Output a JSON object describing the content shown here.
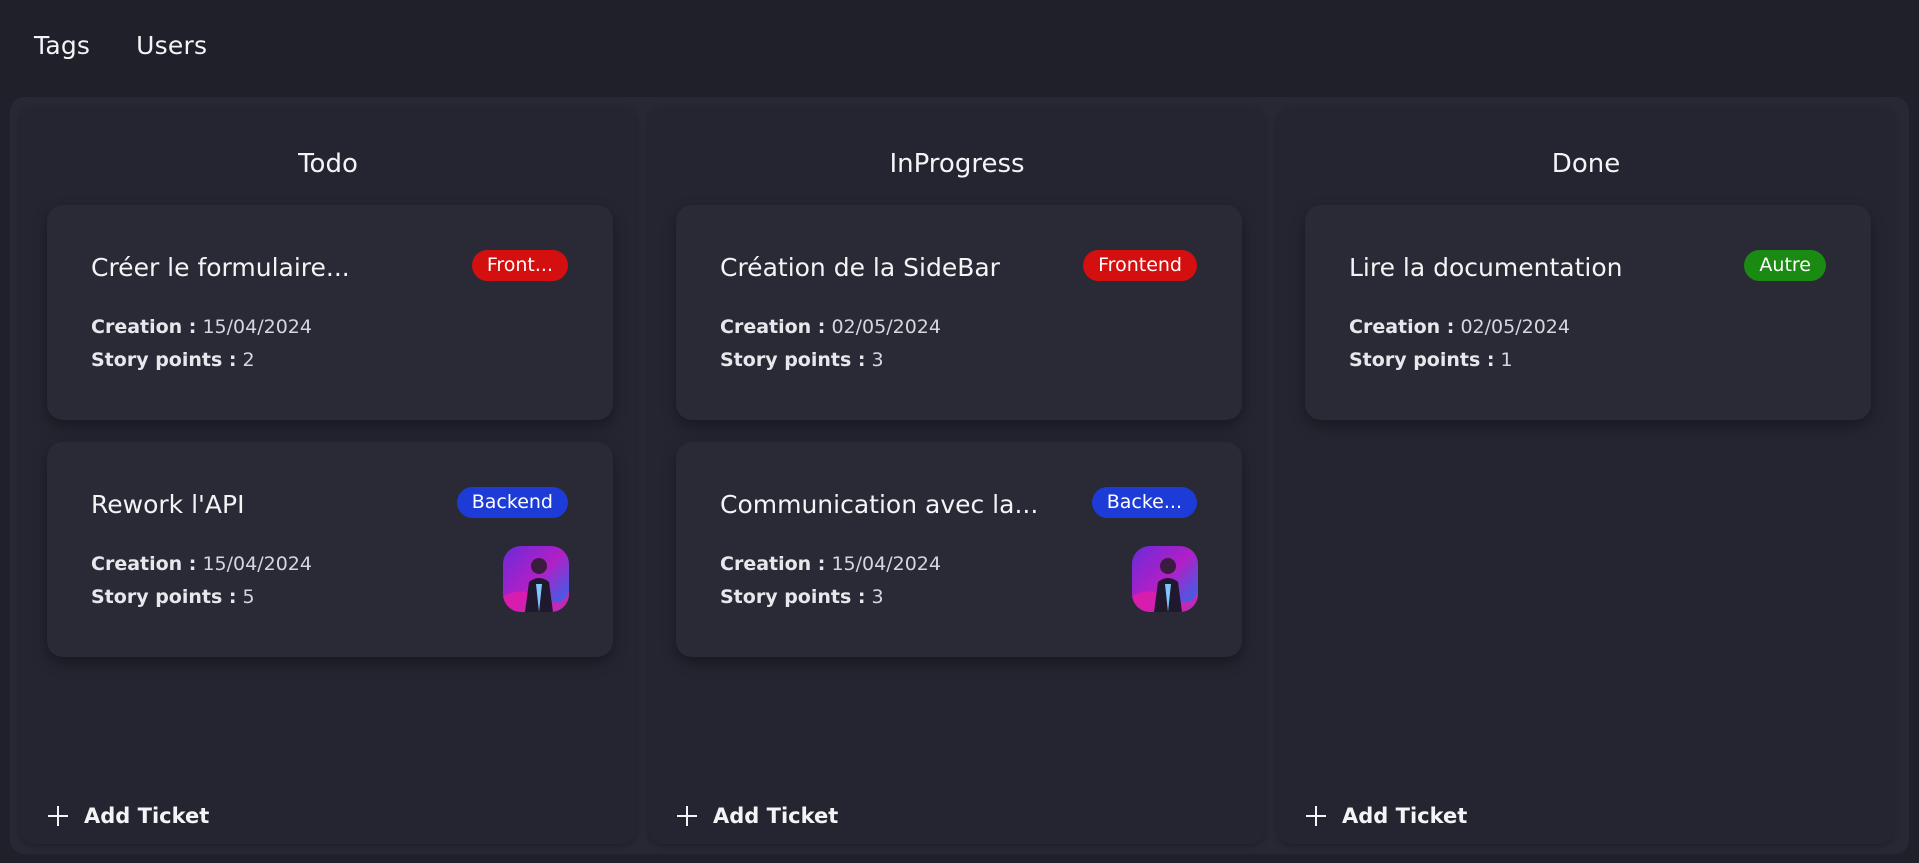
{
  "nav": {
    "tags_label": "Tags",
    "users_label": "Users"
  },
  "colors": {
    "frontend_tag": "#d40f0f",
    "backend_tag": "#1d3bd6",
    "autre_tag": "#1a8a12"
  },
  "columns": [
    {
      "title": "Todo",
      "add_label": "Add Ticket",
      "cards": [
        {
          "title": "Créer le formulaire...",
          "tag": "Front...",
          "creation_label": "Creation :",
          "creation_value": "15/04/2024",
          "points_label": "Story points :",
          "points_value": "2"
        },
        {
          "title": "Rework l'API",
          "tag": "Backend",
          "creation_label": "Creation :",
          "creation_value": "15/04/2024",
          "points_label": "Story points :",
          "points_value": "5",
          "avatar": "user-avatar"
        }
      ]
    },
    {
      "title": "InProgress",
      "add_label": "Add Ticket",
      "cards": [
        {
          "title": "Création de la SideBar",
          "tag": "Frontend",
          "creation_label": "Creation :",
          "creation_value": "02/05/2024",
          "points_label": "Story points :",
          "points_value": "3"
        },
        {
          "title": "Communication avec la...",
          "tag": "Backe...",
          "creation_label": "Creation :",
          "creation_value": "15/04/2024",
          "points_label": "Story points :",
          "points_value": "3",
          "avatar": "user-avatar"
        }
      ]
    },
    {
      "title": "Done",
      "add_label": "Add Ticket",
      "cards": [
        {
          "title": "Lire la documentation",
          "tag": "Autre",
          "creation_label": "Creation :",
          "creation_value": "02/05/2024",
          "points_label": "Story points :",
          "points_value": "1"
        }
      ]
    }
  ]
}
